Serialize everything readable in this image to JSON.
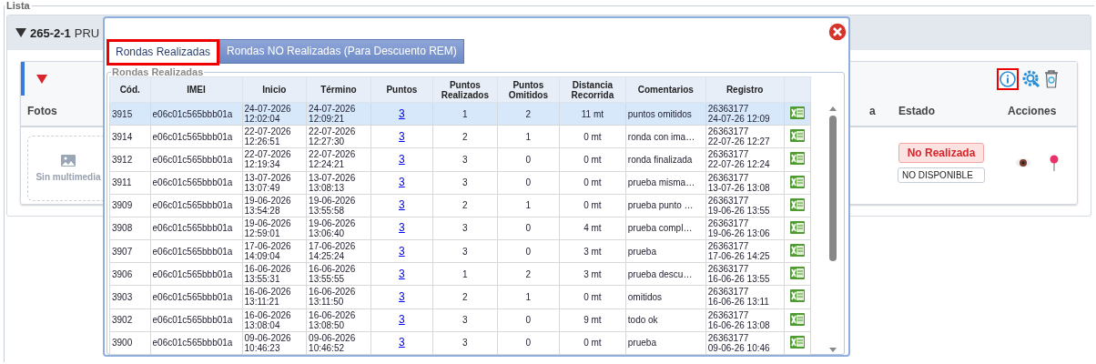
{
  "page": {
    "legend": "Lista",
    "group_code": "265-2-1",
    "group_name": "PRU",
    "columns": [
      "Fotos",
      "a",
      "Estado",
      "Acciones"
    ],
    "media_placeholder": "Sin multimedia",
    "status": "No Realizada",
    "availability": "NO DISPONIBLE"
  },
  "modal": {
    "tabs": [
      {
        "label": "Rondas Realizadas",
        "selected": true
      },
      {
        "label": "Rondas NO Realizadas (Para Descuento REM)",
        "selected": false
      }
    ],
    "legend": "Rondas Realizadas",
    "columns": [
      "Cód.",
      "IMEI",
      "Inicio",
      "Término",
      "Puntos",
      "Puntos Realizados",
      "Puntos Omitidos",
      "Distancia Recorrida",
      "Comentarios",
      "Registro"
    ],
    "rows": [
      {
        "cod": "3915",
        "imei": "e06c01c565bbb01a",
        "inicio": "24-07-2026 12:02:04",
        "termino": "24-07-2026 12:09:21",
        "puntos": "3",
        "realizados": "1",
        "omitidos": "2",
        "distancia": "11 mt",
        "comentario": "puntos omitidos",
        "registro_id": "26363177",
        "registro_time": "24-07-26 12:09",
        "selected": true
      },
      {
        "cod": "3914",
        "imei": "e06c01c565bbb01a",
        "inicio": "22-07-2026 12:26:51",
        "termino": "22-07-2026 12:27:30",
        "puntos": "3",
        "realizados": "2",
        "omitidos": "1",
        "distancia": "0 mt",
        "comentario": "ronda con ima…",
        "registro_id": "26363177",
        "registro_time": "22-07-26 12:27",
        "selected": false
      },
      {
        "cod": "3912",
        "imei": "e06c01c565bbb01a",
        "inicio": "22-07-2026 12:19:34",
        "termino": "22-07-2026 12:24:21",
        "puntos": "3",
        "realizados": "3",
        "omitidos": "0",
        "distancia": "0 mt",
        "comentario": "ronda finalizada",
        "registro_id": "26363177",
        "registro_time": "22-07-26 12:24",
        "selected": false
      },
      {
        "cod": "3911",
        "imei": "e06c01c565bbb01a",
        "inicio": "13-07-2026 13:07:49",
        "termino": "13-07-2026 13:08:13",
        "puntos": "3",
        "realizados": "3",
        "omitidos": "0",
        "distancia": "0 mt",
        "comentario": "prueba misma…",
        "registro_id": "26363177",
        "registro_time": "13-07-26 13:08",
        "selected": false
      },
      {
        "cod": "3909",
        "imei": "e06c01c565bbb01a",
        "inicio": "19-06-2026 13:54:28",
        "termino": "19-06-2026 13:55:58",
        "puntos": "3",
        "realizados": "2",
        "omitidos": "1",
        "distancia": "0 mt",
        "comentario": "prueba punto …",
        "registro_id": "26363177",
        "registro_time": "19-06-26 13:55",
        "selected": false
      },
      {
        "cod": "3908",
        "imei": "e06c01c565bbb01a",
        "inicio": "19-06-2026 12:59:01",
        "termino": "19-06-2026 13:06:40",
        "puntos": "3",
        "realizados": "3",
        "omitidos": "0",
        "distancia": "4 mt",
        "comentario": "prueba compl…",
        "registro_id": "26363177",
        "registro_time": "19-06-26 13:06",
        "selected": false
      },
      {
        "cod": "3907",
        "imei": "e06c01c565bbb01a",
        "inicio": "17-06-2026 14:09:04",
        "termino": "17-06-2026 14:25:24",
        "puntos": "3",
        "realizados": "3",
        "omitidos": "0",
        "distancia": "3 mt",
        "comentario": "prueba",
        "registro_id": "26363177",
        "registro_time": "17-06-26 14:25",
        "selected": false
      },
      {
        "cod": "3906",
        "imei": "e06c01c565bbb01a",
        "inicio": "16-06-2026 13:55:31",
        "termino": "16-06-2026 13:55:55",
        "puntos": "3",
        "realizados": "1",
        "omitidos": "2",
        "distancia": "3 mt",
        "comentario": "prueba descu…",
        "registro_id": "26363177",
        "registro_time": "16-06-26 13:55",
        "selected": false
      },
      {
        "cod": "3903",
        "imei": "e06c01c565bbb01a",
        "inicio": "16-06-2026 13:11:21",
        "termino": "16-06-2026 13:11:50",
        "puntos": "3",
        "realizados": "2",
        "omitidos": "1",
        "distancia": "0 mt",
        "comentario": "omitidos",
        "registro_id": "26363177",
        "registro_time": "16-06-26 13:11",
        "selected": false
      },
      {
        "cod": "3902",
        "imei": "e06c01c565bbb01a",
        "inicio": "16-06-2026 13:08:04",
        "termino": "16-06-2026 13:08:50",
        "puntos": "3",
        "realizados": "3",
        "omitidos": "0",
        "distancia": "9 mt",
        "comentario": "todo ok",
        "registro_id": "26363177",
        "registro_time": "16-06-26 13:08",
        "selected": false
      },
      {
        "cod": "3900",
        "imei": "e06c01c565bbb01a",
        "inicio": "09-06-2026 10:46:23",
        "termino": "09-06-2026 10:46:52",
        "puntos": "3",
        "realizados": "3",
        "omitidos": "0",
        "distancia": "0 mt",
        "comentario": "prueba",
        "registro_id": "26363177",
        "registro_time": "09-06-26 10:46",
        "selected": false
      }
    ]
  }
}
